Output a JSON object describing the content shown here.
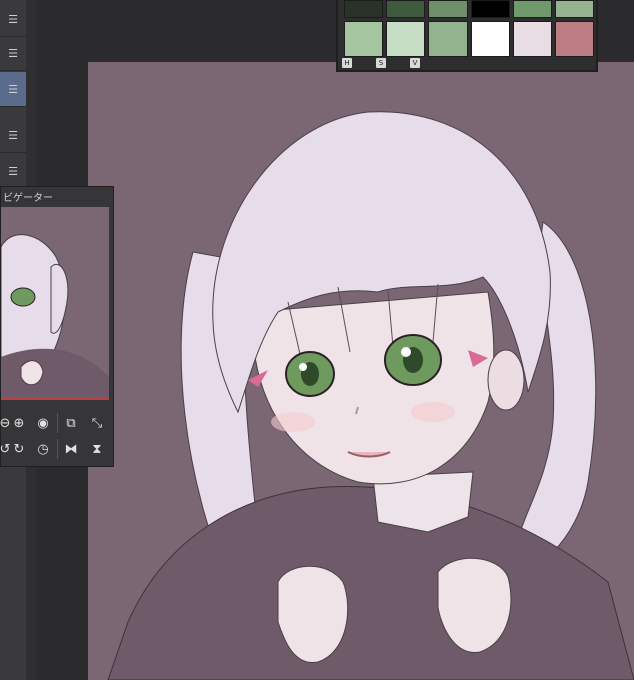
{
  "navigator": {
    "title": "ビゲーター"
  },
  "color_set": {
    "swatches": [
      "#2b3328",
      "#3e5a3c",
      "#6f8f6a",
      "#000000",
      "#6e9a6c",
      "#95b48f",
      "#a5c4a0",
      "#c6dec4",
      "#93b38e",
      "#ffffff",
      "#e7dde3",
      "#bd7d84"
    ],
    "mode_buttons": [
      "H",
      "S",
      "V"
    ]
  },
  "icons": {
    "menu": "menu-icon",
    "zoom_out": "zoom-out-icon",
    "zoom_in": "zoom-in-icon",
    "stop": "stop-icon",
    "fit": "fit-icon",
    "actual": "actual-size-icon",
    "rotate_left": "rotate-left-icon",
    "rotate_right": "rotate-right-icon",
    "reset_rotation": "reset-rotation-icon",
    "flip_h": "flip-horizontal-icon",
    "flip_v": "flip-vertical-icon"
  },
  "colors": {
    "canvas": "#7b6674",
    "hair": "#e6dcea",
    "eye": "#6e9a5e",
    "accent_red": "#b84141"
  }
}
